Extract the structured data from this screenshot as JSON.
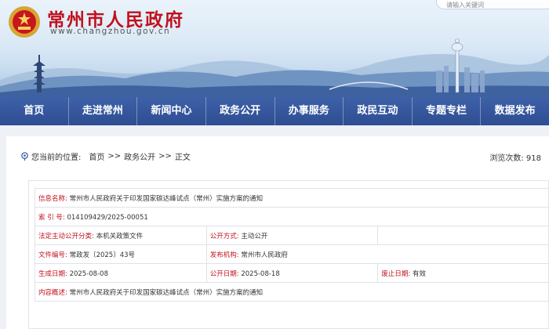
{
  "header": {
    "site_title": "常州市人民政府",
    "site_url": "www.changzhou.gov.cn",
    "search_placeholder": "请输入关键词"
  },
  "nav": {
    "items": [
      {
        "label": "首页"
      },
      {
        "label": "走进常州"
      },
      {
        "label": "新闻中心"
      },
      {
        "label": "政务公开"
      },
      {
        "label": "办事服务"
      },
      {
        "label": "政民互动"
      },
      {
        "label": "专题专栏"
      },
      {
        "label": "数据发布"
      }
    ]
  },
  "breadcrumb": {
    "prefix": "您当前的位置:",
    "items": [
      "首页",
      "政务公开",
      "正文"
    ],
    "separator": ">>"
  },
  "views": {
    "label": "浏览次数:",
    "count": "918"
  },
  "info": {
    "name_label": "信息名称:",
    "name_value": "常州市人民政府关于印发国家碳达峰试点（常州）实施方案的通知",
    "index_label": "索 引 号:",
    "index_value": "014109429/2025-00051",
    "scope_label": "法定主动公开分类:",
    "scope_value": "本机关政策文件",
    "method_label": "公开方式:",
    "method_value": "主动公开",
    "doc_no_label": "文件编号:",
    "doc_no_value": "常政发〔2025〕43号",
    "issuer_label": "发布机构:",
    "issuer_value": "常州市人民政府",
    "created_label": "生成日期:",
    "created_value": "2025-08-08",
    "published_label": "公开日期:",
    "published_value": "2025-08-18",
    "expiry_label": "废止日期:",
    "expiry_value": "有效",
    "summary_label": "内容概述:",
    "summary_value": "常州市人民政府关于印发国家碳达峰试点（常州）实施方案的通知"
  },
  "colors": {
    "brand_red": "#c0121d",
    "nav_blue": "#2e4d92"
  }
}
